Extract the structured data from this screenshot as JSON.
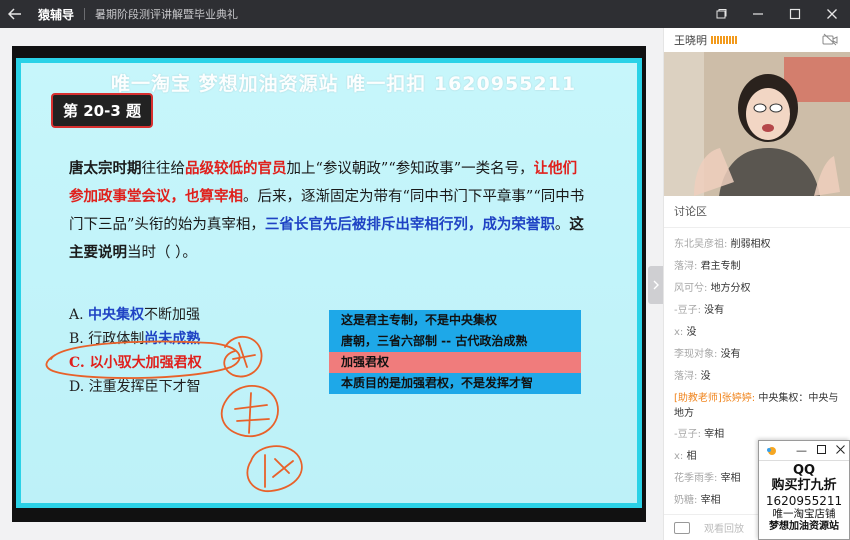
{
  "titlebar": {
    "back_icon": "arrow-left-icon",
    "app_name": "猿辅导",
    "course_title": "暑期阶段测评讲解暨毕业典礼",
    "controls": [
      "restore-icon",
      "minimize-icon",
      "maximize-icon",
      "close-icon"
    ]
  },
  "slide": {
    "watermark": "唯一淘宝  梦想加油资源站  唯一扣扣  1620955211",
    "badge": "第 20-3 题",
    "question": {
      "p1": "唐太宗时期",
      "p2": "往往给",
      "p3": "品级较低的官员",
      "p4": "加上“参议朝政”“参知政事”一类名号，",
      "p5": "让他们参加政事堂会议，也算宰相",
      "p6": "。后来，逐渐固定为带有“同中书门下平章事”“同中书门下三品”头衔的始为真宰相，",
      "p7": "三省长官先后被排斥出宰相行列，成为荣誉职",
      "p8": "。",
      "p9": "这主要说明",
      "p10": "当时（    ）。"
    },
    "options": {
      "a_prefix": "A. ",
      "a_hl": "中央集权",
      "a_rest": "不断加强",
      "b_prefix": "B. 行政体制",
      "b_hl": "尚未成熟",
      "c": "C. 以小驭大加强君权",
      "d": "D. 注重发挥臣下才智"
    },
    "notes": [
      "这是君主专制，不是中央集权",
      "唐朝，三省六部制 -- 古代政治成熟",
      "加强君权",
      "本质目的是加强君权，不是发挥才智"
    ],
    "colors": {
      "note_blue": "#1ea8e8",
      "note_red": "#f07c7c",
      "ink": "#e8612a",
      "frame": "#2ad2e7"
    }
  },
  "side": {
    "teacher_name": "王晓明",
    "chat_tab": "讨论区",
    "messages": [
      {
        "name": "东北吴彦祖:",
        "text": "削弱相权"
      },
      {
        "name": "落浔:",
        "text": "君主专制"
      },
      {
        "name": "风可兮:",
        "text": "地方分权"
      },
      {
        "name": "-豆子:",
        "text": "没有"
      },
      {
        "name": "x:",
        "text": "没"
      },
      {
        "name": "李现对象:",
        "text": "没有"
      },
      {
        "name": "落浔:",
        "text": "没"
      },
      {
        "name": "[助教老师]张婷婷:",
        "text": "中央集权：中央与地方"
      },
      {
        "name": "-豆子:",
        "text": "宰相"
      },
      {
        "name": "x:",
        "text": "相"
      },
      {
        "name": "花季雨季:",
        "text": "宰相"
      },
      {
        "name": "奶糖:",
        "text": "宰相"
      }
    ],
    "replay_placeholder": "观看回放"
  },
  "ad": {
    "qq": "QQ",
    "discount": "购买打九折",
    "number": "1620955211",
    "shop": "唯一淘宝店铺",
    "site": "梦想加油资源站"
  }
}
